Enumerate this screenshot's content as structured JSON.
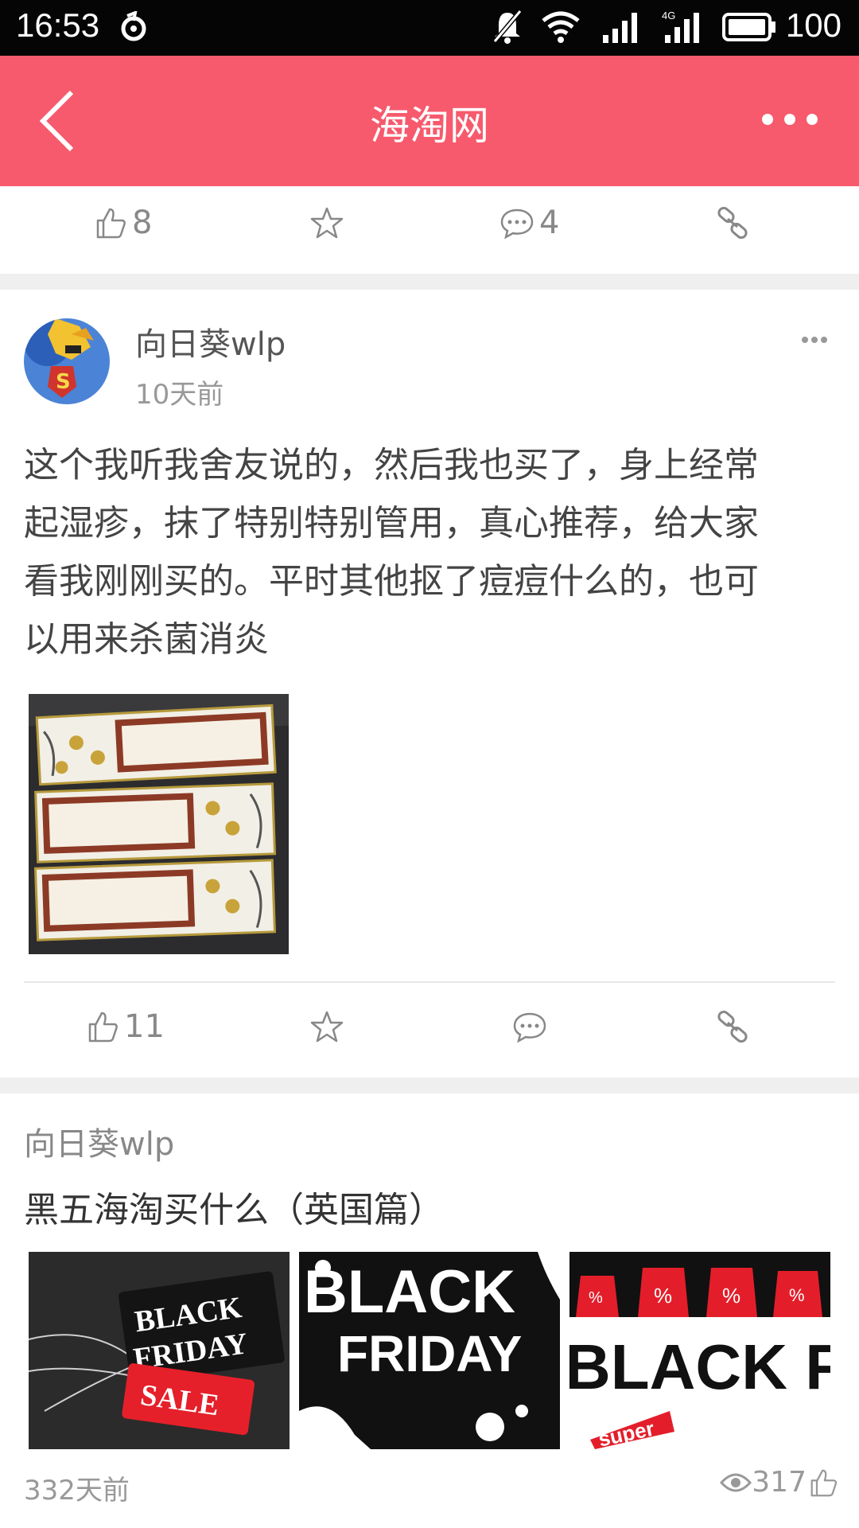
{
  "status_bar": {
    "time": "16:53",
    "battery": "100",
    "network": "4G"
  },
  "app_bar": {
    "title": "海淘网"
  },
  "top_actions": {
    "like_count": "8",
    "comment_count": "4"
  },
  "post": {
    "author": "向日葵wlp",
    "time": "10天前",
    "text_lines": [
      "这个我听我舍友说的，然后我也买了，身上经常",
      "起湿疹，抹了特别特别管用，真心推荐，给大家",
      "看我刚刚买的。平时其他抠了痘痘什么的，也可",
      "以用来杀菌消炎"
    ],
    "like_count": "11"
  },
  "recommendation": {
    "author": "向日葵wlp",
    "title": "黑五海淘买什么（英国篇）",
    "images": [
      {
        "line1": "BLACK",
        "line2": "FRIDAY",
        "tag": "SALE"
      },
      {
        "line1": "BLACK",
        "line2": "FRIDAY"
      },
      {
        "line1": "BLACK FRI",
        "tag": "super",
        "badges": [
          "%",
          "%",
          "%",
          "%"
        ]
      }
    ],
    "time": "332天前",
    "views": "317"
  },
  "colors": {
    "accent": "#f75a6d",
    "status_bar": "#050505",
    "separator": "#efefef"
  },
  "icons": [
    "back-icon",
    "more-icon",
    "thumb-up-icon",
    "star-icon",
    "comment-icon",
    "link-icon",
    "eye-icon"
  ]
}
